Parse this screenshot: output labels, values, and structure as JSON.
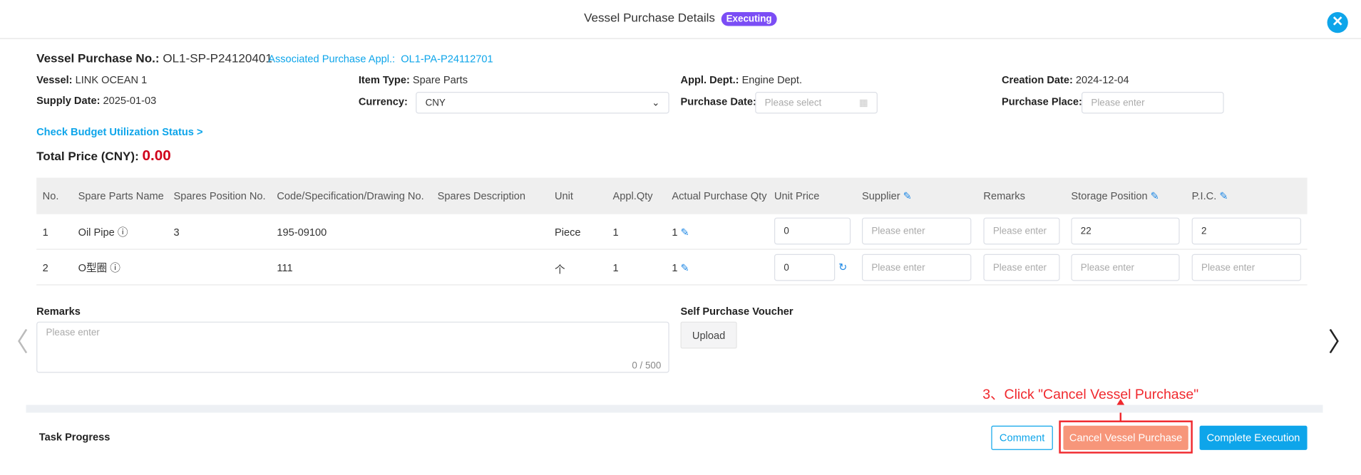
{
  "header": {
    "title": "Vessel Purchase Details",
    "status": "Executing",
    "close_icon": "close-icon"
  },
  "info": {
    "purchase_no_label": "Vessel Purchase No.:",
    "purchase_no": "OL1-SP-P24120401",
    "assoc_label": "Associated Purchase Appl.:",
    "assoc_value": "OL1-PA-P24112701",
    "vessel_label": "Vessel:",
    "vessel": "LINK OCEAN 1",
    "item_type_label": "Item Type:",
    "item_type": "Spare Parts",
    "dept_label": "Appl. Dept.:",
    "dept": "Engine Dept.",
    "creation_label": "Creation Date:",
    "creation": "2024-12-04",
    "supply_label": "Supply Date:",
    "supply": "2025-01-03",
    "currency_label": "Currency:",
    "currency": "CNY",
    "purchase_date_label": "Purchase Date:",
    "purchase_date_placeholder": "Please select",
    "purchase_place_label": "Purchase Place:",
    "purchase_place_placeholder": "Please enter",
    "budget_link": "Check Budget Utilization Status >",
    "total_label": "Total Price (CNY):",
    "total": "0.00"
  },
  "table": {
    "columns": [
      "No.",
      "Spare Parts Name",
      "Spares Position No.",
      "Code/Specification/Drawing No.",
      "Spares Description",
      "Unit",
      "Appl.Qty",
      "Actual Purchase Qty",
      "Unit Price",
      "Supplier",
      "Remarks",
      "Storage Position",
      "P.I.C."
    ],
    "rows": [
      {
        "no": "1",
        "name": "Oil Pipe",
        "position": "3",
        "code": "195-09100",
        "desc": "",
        "unit": "Piece",
        "appl_qty": "1",
        "actual_qty": "1",
        "unit_price": "0",
        "supplier": "",
        "remarks": "",
        "storage": "22",
        "pic": "2"
      },
      {
        "no": "2",
        "name": "O型圈",
        "position": "",
        "code": "111",
        "desc": "",
        "unit": "个",
        "appl_qty": "1",
        "actual_qty": "1",
        "unit_price": "0",
        "supplier": "",
        "remarks": "",
        "storage": "",
        "pic": ""
      }
    ],
    "placeholder": "Please enter"
  },
  "remarks": {
    "label": "Remarks",
    "placeholder": "Please enter",
    "counter": "0 / 500"
  },
  "voucher": {
    "label": "Self Purchase Voucher",
    "upload": "Upload"
  },
  "annotation": {
    "text": "3、Click \"Cancel Vessel Purchase\"",
    "color": "#f0282d"
  },
  "footer": {
    "task_progress": "Task Progress",
    "comment": "Comment",
    "cancel": "Cancel Vessel Purchase",
    "complete": "Complete Execution"
  }
}
